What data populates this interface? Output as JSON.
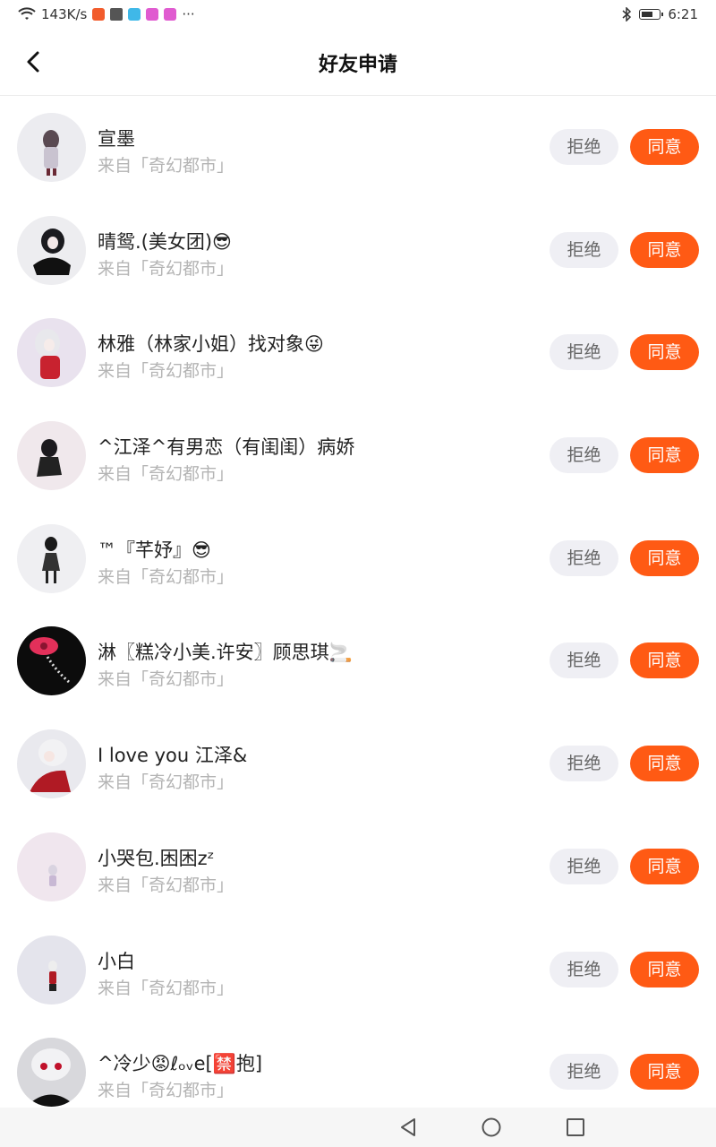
{
  "status_bar": {
    "network_speed": "143K/s",
    "more": "···",
    "time": "6:21",
    "battery_level": 0.7
  },
  "nav": {
    "title": "好友申请"
  },
  "requests": [
    {
      "name": "宣墨",
      "source": "来自「奇幻都市」",
      "reject": "拒绝",
      "accept": "同意"
    },
    {
      "name": "晴鸳.(美女团)😎",
      "source": "来自「奇幻都市」",
      "reject": "拒绝",
      "accept": "同意"
    },
    {
      "name": "林雅（林家小姐）找对象😜",
      "source": "来自「奇幻都市」",
      "reject": "拒绝",
      "accept": "同意"
    },
    {
      "name": "^江泽^有男恋（有闺闺）病娇",
      "source": "来自「奇幻都市」",
      "reject": "拒绝",
      "accept": "同意"
    },
    {
      "name": "™『芊妤』😎",
      "source": "来自「奇幻都市」",
      "reject": "拒绝",
      "accept": "同意"
    },
    {
      "name": "淋〖糕冷小美.许安〗顾思琪🚬",
      "source": "来自「奇幻都市」",
      "reject": "拒绝",
      "accept": "同意"
    },
    {
      "name": "I love you 江泽&",
      "source": "来自「奇幻都市」",
      "reject": "拒绝",
      "accept": "同意"
    },
    {
      "name": "小哭包.困困zᶻ",
      "source": "来自「奇幻都市」",
      "reject": "拒绝",
      "accept": "同意"
    },
    {
      "name": "小白",
      "source": "来自「奇幻都市」",
      "reject": "拒绝",
      "accept": "同意"
    },
    {
      "name": "^冷少😡ℓₒᵥe[🈲抱]",
      "source": "来自「奇幻都市」",
      "reject": "拒绝",
      "accept": "同意"
    }
  ],
  "colors": {
    "accent": "#ff5a14",
    "reject_bg": "#efeff4",
    "subtext": "#b4b4b4"
  }
}
